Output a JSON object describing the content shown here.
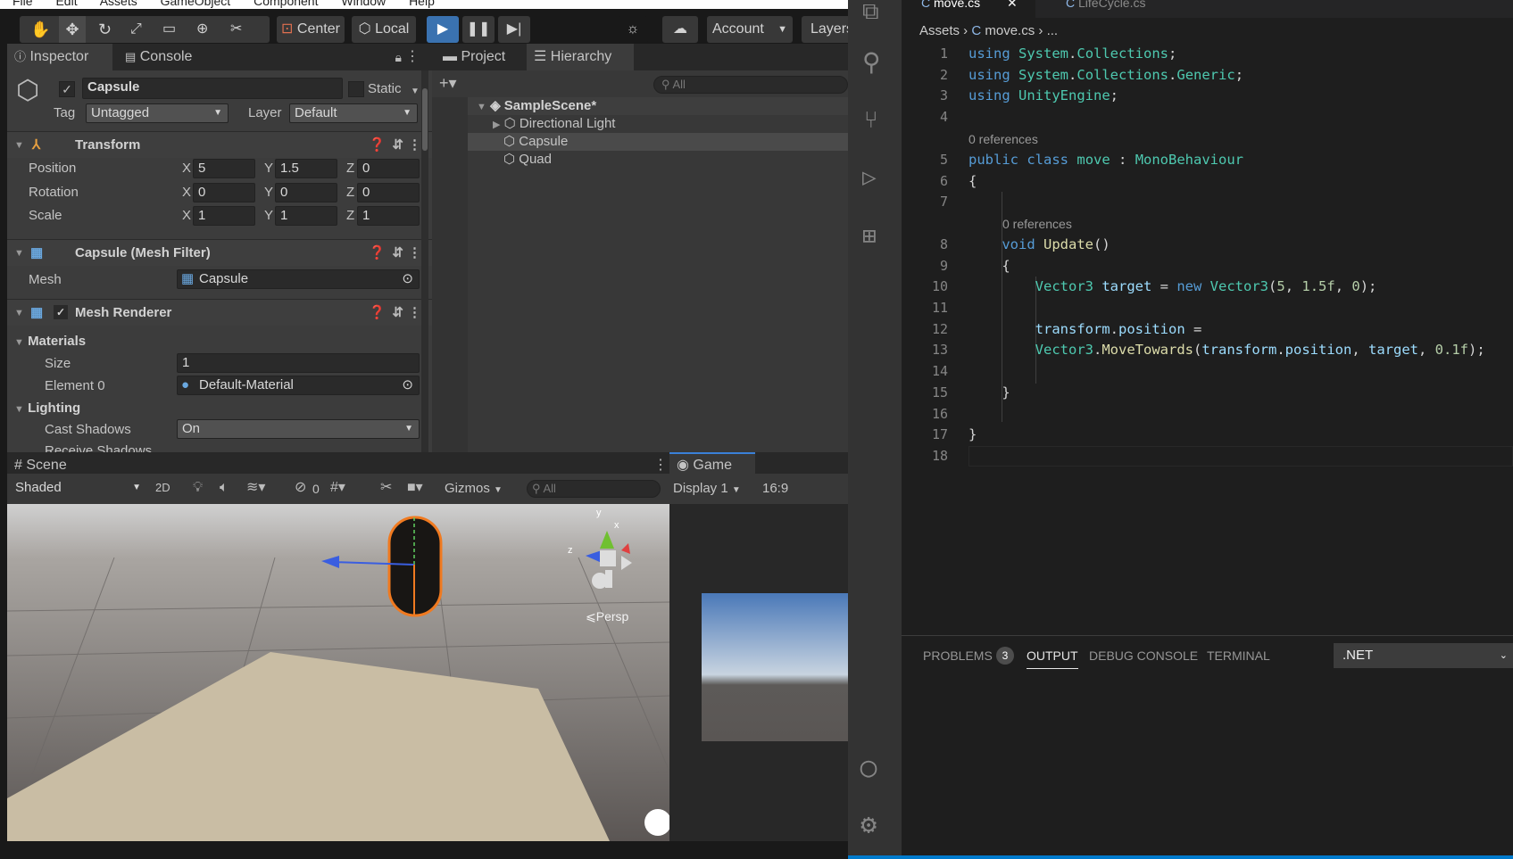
{
  "unity": {
    "menu": [
      "File",
      "Edit",
      "Assets",
      "GameObject",
      "Component",
      "Window",
      "Help"
    ],
    "toolbar": {
      "center_label": "Center",
      "local_label": "Local",
      "account_label": "Account",
      "layers_label": "Layers"
    },
    "inspector": {
      "tabs": [
        "Inspector",
        "Console"
      ],
      "object_name": "Capsule",
      "static_label": "Static",
      "tag_label": "Tag",
      "tag_value": "Untagged",
      "layer_label": "Layer",
      "layer_value": "Default",
      "transform": {
        "title": "Transform",
        "position_label": "Position",
        "position": {
          "x": "5",
          "y": "1.5",
          "z": "0"
        },
        "rotation_label": "Rotation",
        "rotation": {
          "x": "0",
          "y": "0",
          "z": "0"
        },
        "scale_label": "Scale",
        "scale": {
          "x": "1",
          "y": "1",
          "z": "1"
        }
      },
      "mesh_filter": {
        "title": "Capsule (Mesh Filter)",
        "mesh_label": "Mesh",
        "mesh_value": "Capsule"
      },
      "mesh_renderer": {
        "title": "Mesh Renderer",
        "materials_label": "Materials",
        "size_label": "Size",
        "size_value": "1",
        "element0_label": "Element 0",
        "element0_value": "Default-Material",
        "lighting_label": "Lighting",
        "cast_shadows_label": "Cast Shadows",
        "cast_shadows_value": "On",
        "receive_shadows_label": "Receive Shadows"
      }
    },
    "hierarchy": {
      "tabs": [
        "Project",
        "Hierarchy"
      ],
      "search_placeholder": "All",
      "scene": "SampleScene*",
      "items": [
        "Directional Light",
        "Capsule",
        "Quad"
      ]
    },
    "scene_view": {
      "tab": "Scene",
      "shading": "Shaded",
      "mode_2d": "2D",
      "hidden_count": "0",
      "gizmos": "Gizmos",
      "search_placeholder": "All",
      "persp": "Persp",
      "axis_x": "x",
      "axis_y": "y",
      "axis_z": "z"
    },
    "game_view": {
      "tab": "Game",
      "display": "Display 1",
      "aspect": "16:9"
    }
  },
  "vscode": {
    "tabs": [
      "move.cs",
      "LifeCycle.cs"
    ],
    "breadcrumb": {
      "root": "Assets",
      "file": "move.cs",
      "rest": "..."
    },
    "line_numbers": [
      "1",
      "2",
      "3",
      "4",
      "5",
      "6",
      "7",
      "8",
      "9",
      "10",
      "11",
      "12",
      "13",
      "14",
      "15",
      "16",
      "17",
      "18"
    ],
    "codelens": [
      "0 references",
      "0 references"
    ],
    "panel": {
      "problems": "PROBLEMS",
      "problems_count": "3",
      "output": "OUTPUT",
      "debug": "DEBUG CONSOLE",
      "terminal": "TERMINAL",
      "dropdown": ".NET"
    }
  }
}
